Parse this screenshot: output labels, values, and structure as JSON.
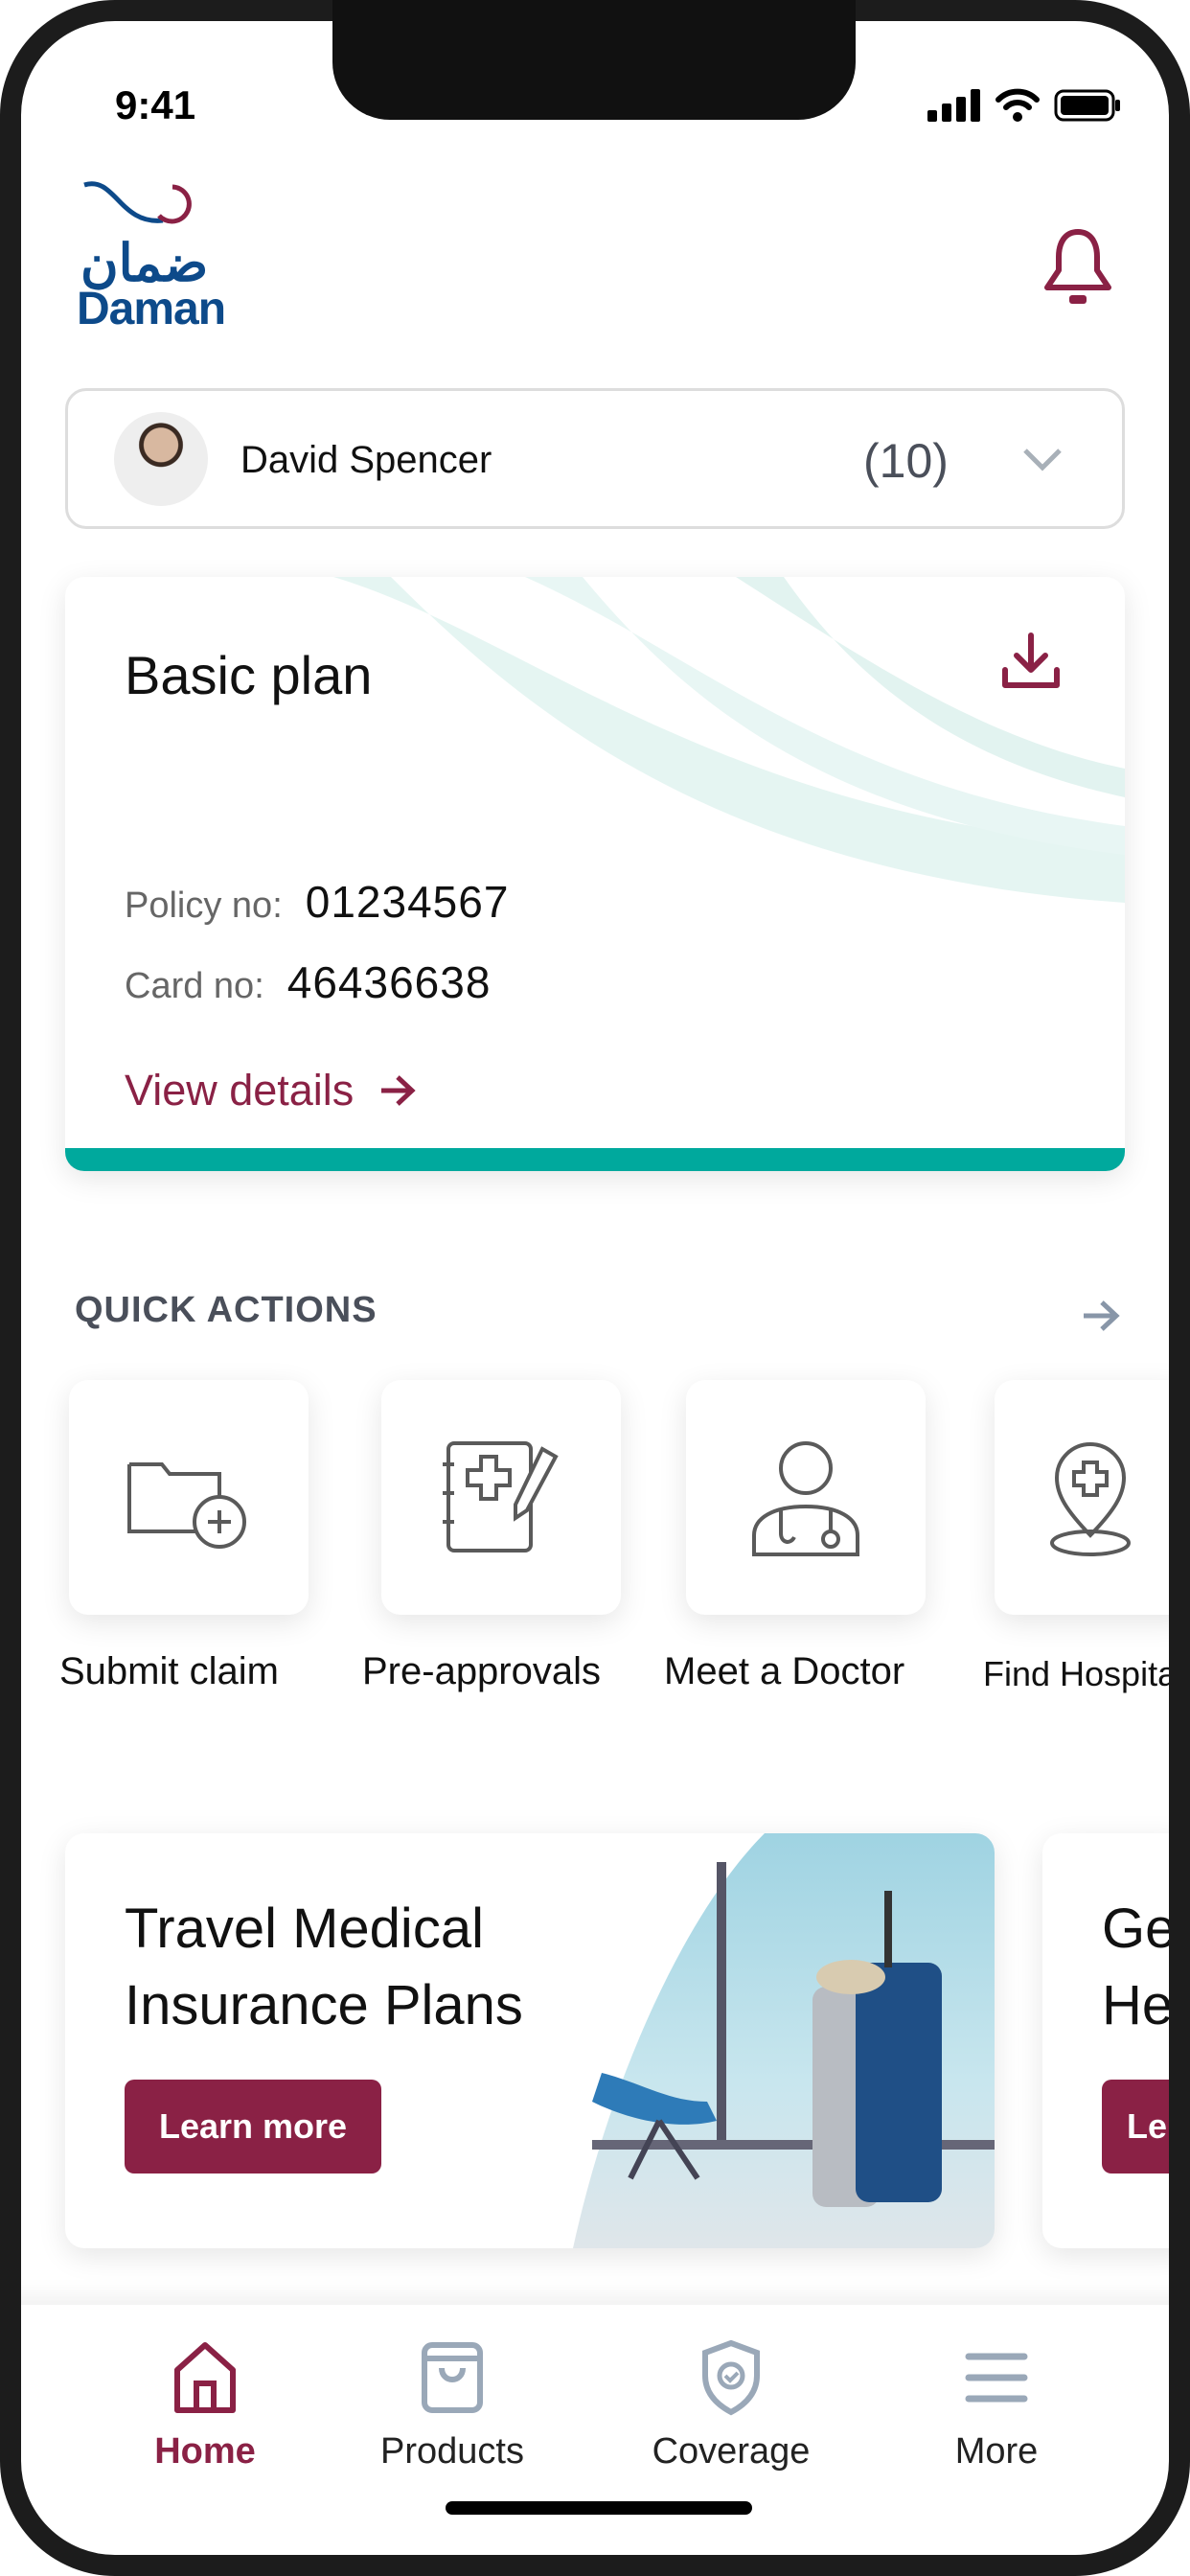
{
  "status_bar": {
    "time": "9:41"
  },
  "header": {
    "logo_text_ar": "ضمان",
    "logo_text_en": "Daman"
  },
  "member": {
    "name": "David Spencer",
    "count": "(10)"
  },
  "plan": {
    "title": "Basic plan",
    "policy_label": "Policy no:",
    "policy_no": "01234567",
    "card_label": "Card no:",
    "card_no": "46436638",
    "view_details": "View details"
  },
  "quick_actions": {
    "title": "QUICK ACTIONS",
    "items": [
      {
        "label": "Submit claim",
        "icon": "folder-plus-icon"
      },
      {
        "label": "Pre-approvals",
        "icon": "document-medical-pen-icon"
      },
      {
        "label": "Meet a Doctor",
        "icon": "doctor-icon"
      },
      {
        "label": "Find Hospital",
        "icon": "location-plus-icon"
      }
    ]
  },
  "banners": [
    {
      "title_line1": "Travel Medical",
      "title_line2": "Insurance Plans",
      "button": "Learn more"
    },
    {
      "title_line1": "Ge",
      "title_line2": "He",
      "button": "Le"
    }
  ],
  "nav": {
    "items": [
      {
        "label": "Home",
        "active": true
      },
      {
        "label": "Products"
      },
      {
        "label": "Coverage"
      },
      {
        "label": "More"
      }
    ]
  },
  "colors": {
    "brand": "#8a2145",
    "accent": "#00a99d",
    "logo_blue": "#0d4a8a",
    "icon_gray": "#9aa8b8"
  }
}
